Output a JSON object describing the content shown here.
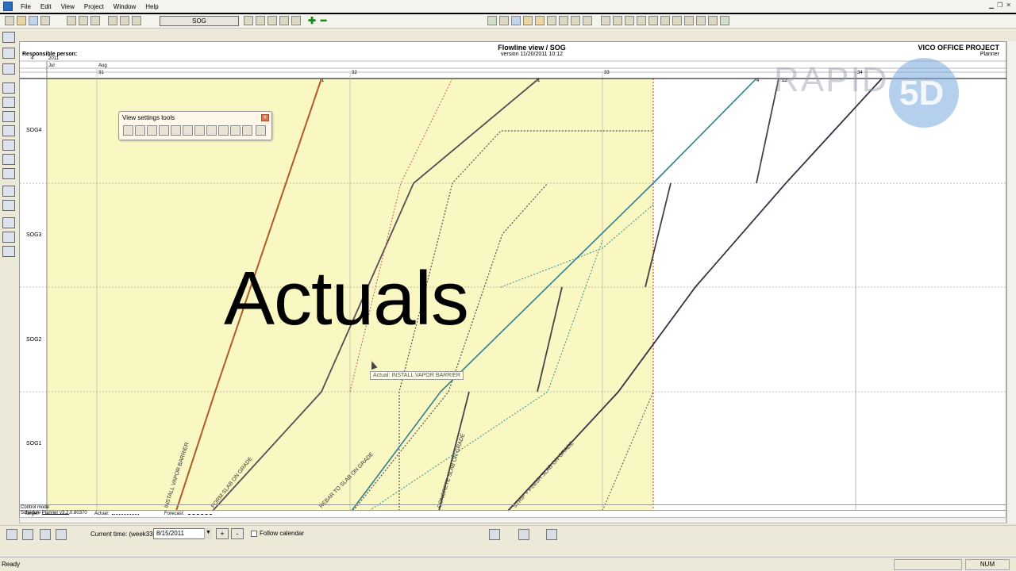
{
  "app": {
    "menu": [
      "File",
      "Edit",
      "View",
      "Project",
      "Window",
      "Help"
    ]
  },
  "toolbar": {
    "location_filter": "SOG"
  },
  "header": {
    "title": "Flowline view / SOG",
    "version": "version 11/20/2011 10:12",
    "company": "VICO OFFICE PROJECT",
    "role": "Planner",
    "responsible": "Responsible person:"
  },
  "timeline": {
    "year": "2011",
    "year_prefix": "4",
    "months": [
      "Jul",
      "Aug"
    ],
    "weeks": [
      "31",
      "32",
      "33",
      "34"
    ],
    "week_flow_marks": [
      "1",
      "1",
      "4",
      "12"
    ]
  },
  "rows": [
    "SOG4",
    "SOG3",
    "SOG2",
    "SOG1"
  ],
  "tasks": [
    "INSTALL VAPOR BARRIER",
    "FORM SLAB ON GRADE",
    "REBAR TO SLAB ON GRADE",
    "CONCRETE SLAB ON GRADE",
    "STRIP + FINISH SLAB ON GRADE"
  ],
  "legend": {
    "target": "Target:",
    "actual": "Actual:",
    "forecast": "Forecast:"
  },
  "status_lines": {
    "mode": "Control mode",
    "version": "Schedule Planner v3.2.0.80370"
  },
  "view_settings": {
    "title": "View settings tools"
  },
  "overlay": {
    "caption": "Actuals",
    "tooltip": "Actual: INSTALL VAPOR BARRIER",
    "watermark": "RAPID",
    "watermark_badge": "5D"
  },
  "bottom": {
    "current_time_label": "Current time: (week33)",
    "current_date": "8/15/2011",
    "plus": "+",
    "minus": "-",
    "follow_calendar": "Follow calendar"
  },
  "status": {
    "ready": "Ready",
    "num": "NUM"
  },
  "colors": {
    "actual_zone": "#f9f7c2",
    "install_vapor": "#b05a2a",
    "form": "#5a4a55",
    "rebar": "#c06060",
    "concrete": "#4a4248",
    "strip_finish": "#3e2e44",
    "teal": "#2f8f8f",
    "now_line": "#c02020"
  }
}
